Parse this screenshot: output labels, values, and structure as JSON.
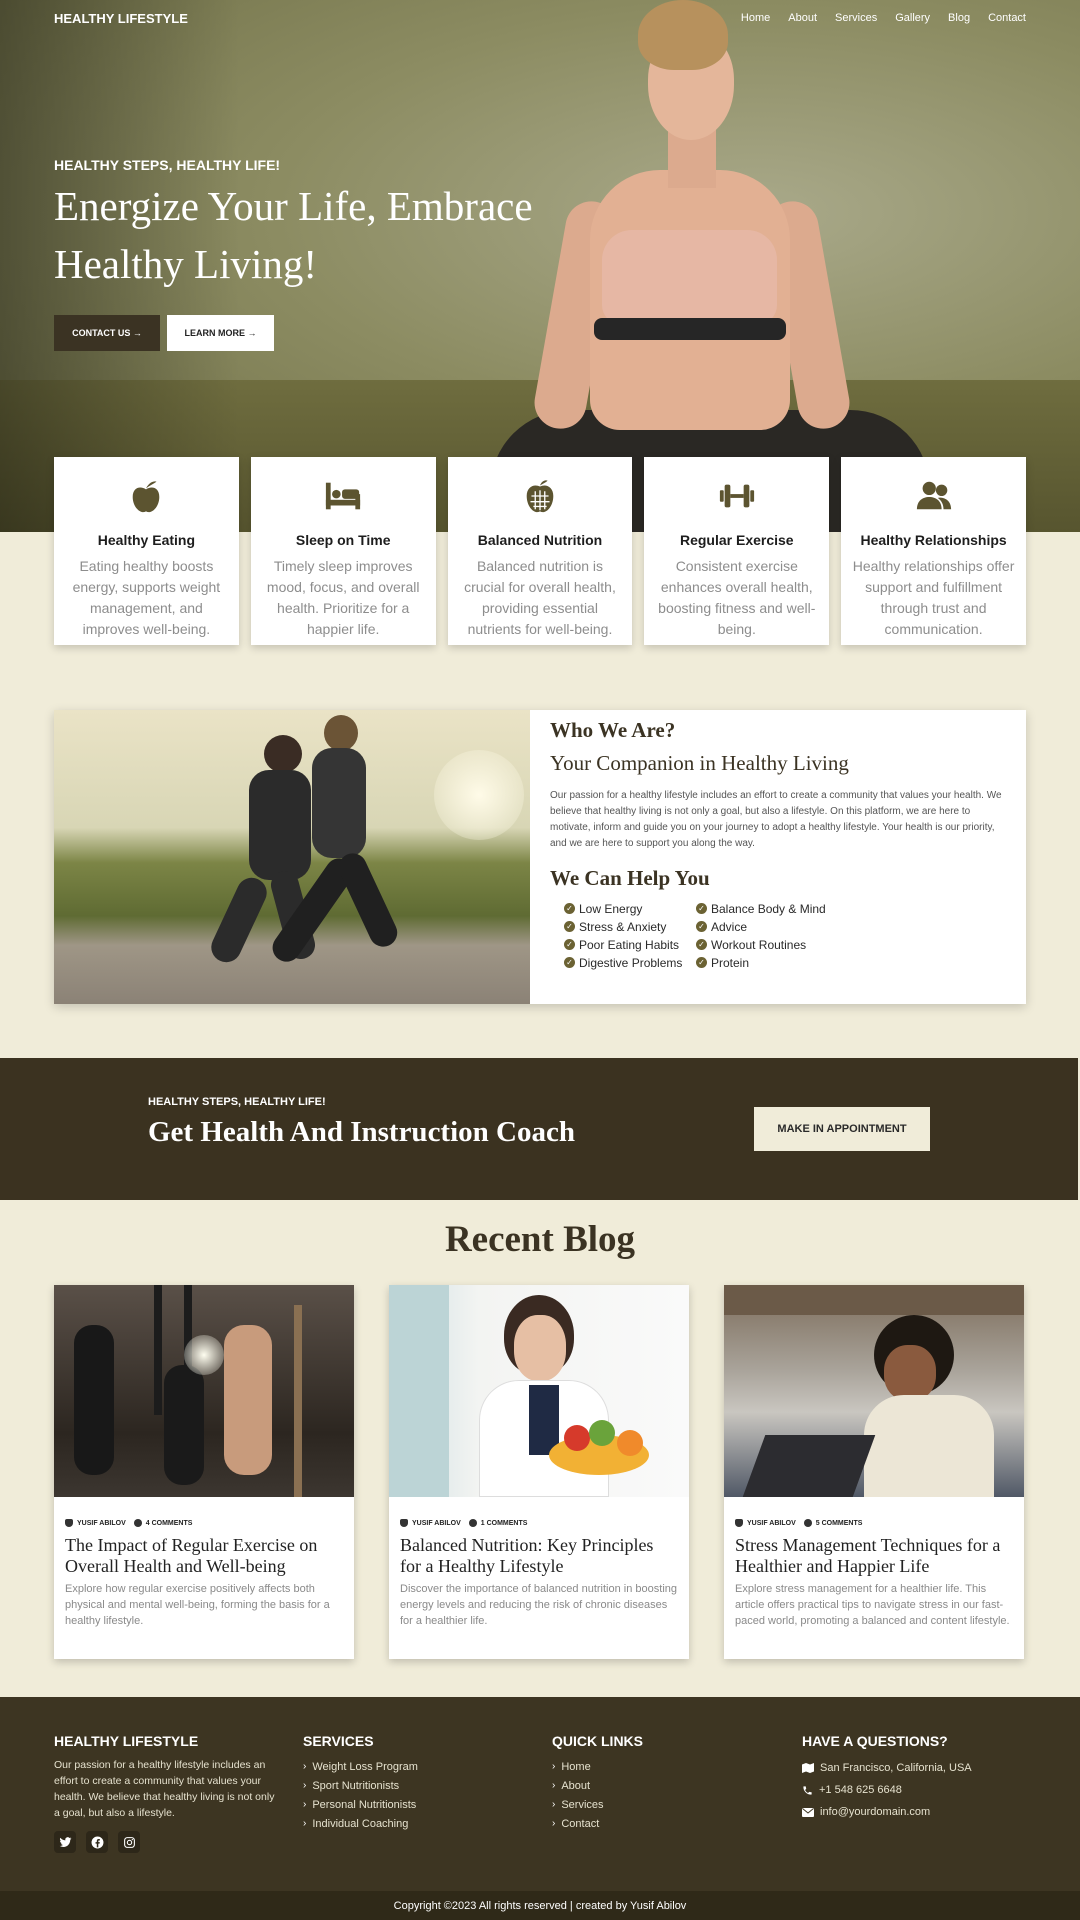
{
  "nav": {
    "brand": "HEALTHY LIFESTYLE",
    "items": [
      "Home",
      "About",
      "Services",
      "Gallery",
      "Blog",
      "Contact"
    ]
  },
  "hero": {
    "kicker": "HEALTHY STEPS, HEALTHY LIFE!",
    "title": "Energize Your Life, Embrace Healthy Living!",
    "contact_button": "CONTACT US →",
    "learn_button": "LEARN MORE →"
  },
  "features": [
    {
      "icon": "apple-icon",
      "title": "Healthy Eating",
      "text": "Eating healthy boosts energy, supports weight management, and improves well-being."
    },
    {
      "icon": "bed-icon",
      "title": "Sleep on Time",
      "text": "Timely sleep improves mood, focus, and overall health. Prioritize for a happier life."
    },
    {
      "icon": "apple-whole-icon",
      "title": "Balanced Nutrition",
      "text": "Balanced nutrition is crucial for overall health, providing essential nutrients for well-being."
    },
    {
      "icon": "dumbbell-icon",
      "title": "Regular Exercise",
      "text": "Consistent exercise enhances overall health, boosting fitness and well-being."
    },
    {
      "icon": "users-icon",
      "title": "Healthy Relationships",
      "text": "Healthy relationships offer support and fulfillment through trust and communication."
    }
  ],
  "about": {
    "heading": "Who We Are?",
    "subheading": "Your Companion in Healthy Living",
    "paragraph": "Our passion for a healthy lifestyle includes an effort to create a community that values your health. We believe that healthy living is not only a goal, but also a lifestyle. On this platform, we are here to motivate, inform and guide you on your journey to adopt a healthy lifestyle. Your health is our priority, and we are here to support you along the way.",
    "help_heading": "We Can Help You",
    "help_items": [
      "Low Energy",
      "Balance Body & Mind",
      "Stress & Anxiety",
      "Advice",
      "Poor Eating Habits",
      "Workout Routines",
      "Digestive Problems",
      "Protein"
    ]
  },
  "cta": {
    "kicker": "HEALTHY STEPS, HEALTHY LIFE!",
    "title": "Get Health And Instruction Coach",
    "button": "MAKE IN APPOINTMENT"
  },
  "blog": {
    "title": "Recent Blog",
    "posts": [
      {
        "author": "YUSIF ABILOV",
        "comments": "4 COMMENTS",
        "title": "The Impact of Regular Exercise on Overall Health and Well-being",
        "text": "Explore how regular exercise positively affects both physical and mental well-being, forming the basis for a healthy lifestyle."
      },
      {
        "author": "YUSIF ABILOV",
        "comments": "1 COMMENTS",
        "title": "Balanced Nutrition: Key Principles for a Healthy Lifestyle",
        "text": "Discover the importance of balanced nutrition in boosting energy levels and reducing the risk of chronic diseases for a healthier life."
      },
      {
        "author": "YUSIF ABILOV",
        "comments": "5 COMMENTS",
        "title": "Stress Management Techniques for a Healthier and Happier Life",
        "text": "Explore stress management for a healthier life. This article offers practical tips to navigate stress in our fast-paced world, promoting a balanced and content lifestyle."
      }
    ]
  },
  "footer": {
    "about_title": "HEALTHY LIFESTYLE",
    "about_text": "Our passion for a healthy lifestyle includes an effort to create a community that values your health. We believe that healthy living is not only a goal, but also a lifestyle.",
    "services_title": "SERVICES",
    "services": [
      "Weight Loss Program",
      "Sport Nutritionists",
      "Personal Nutritionists",
      "Individual Coaching"
    ],
    "links_title": "QUICK LINKS",
    "links": [
      "Home",
      "About",
      "Services",
      "Contact"
    ],
    "contact_title": "HAVE A QUESTIONS?",
    "address": "San Francisco, California, USA",
    "phone": "+1 548 625 6648",
    "email": "info@yourdomain.com",
    "copyright": "Copyright ©2023 All rights reserved | created by Yusif Abilov"
  },
  "colors": {
    "accent": "#3b3323",
    "cream": "#f0ecd9",
    "icon": "#5c5430"
  }
}
